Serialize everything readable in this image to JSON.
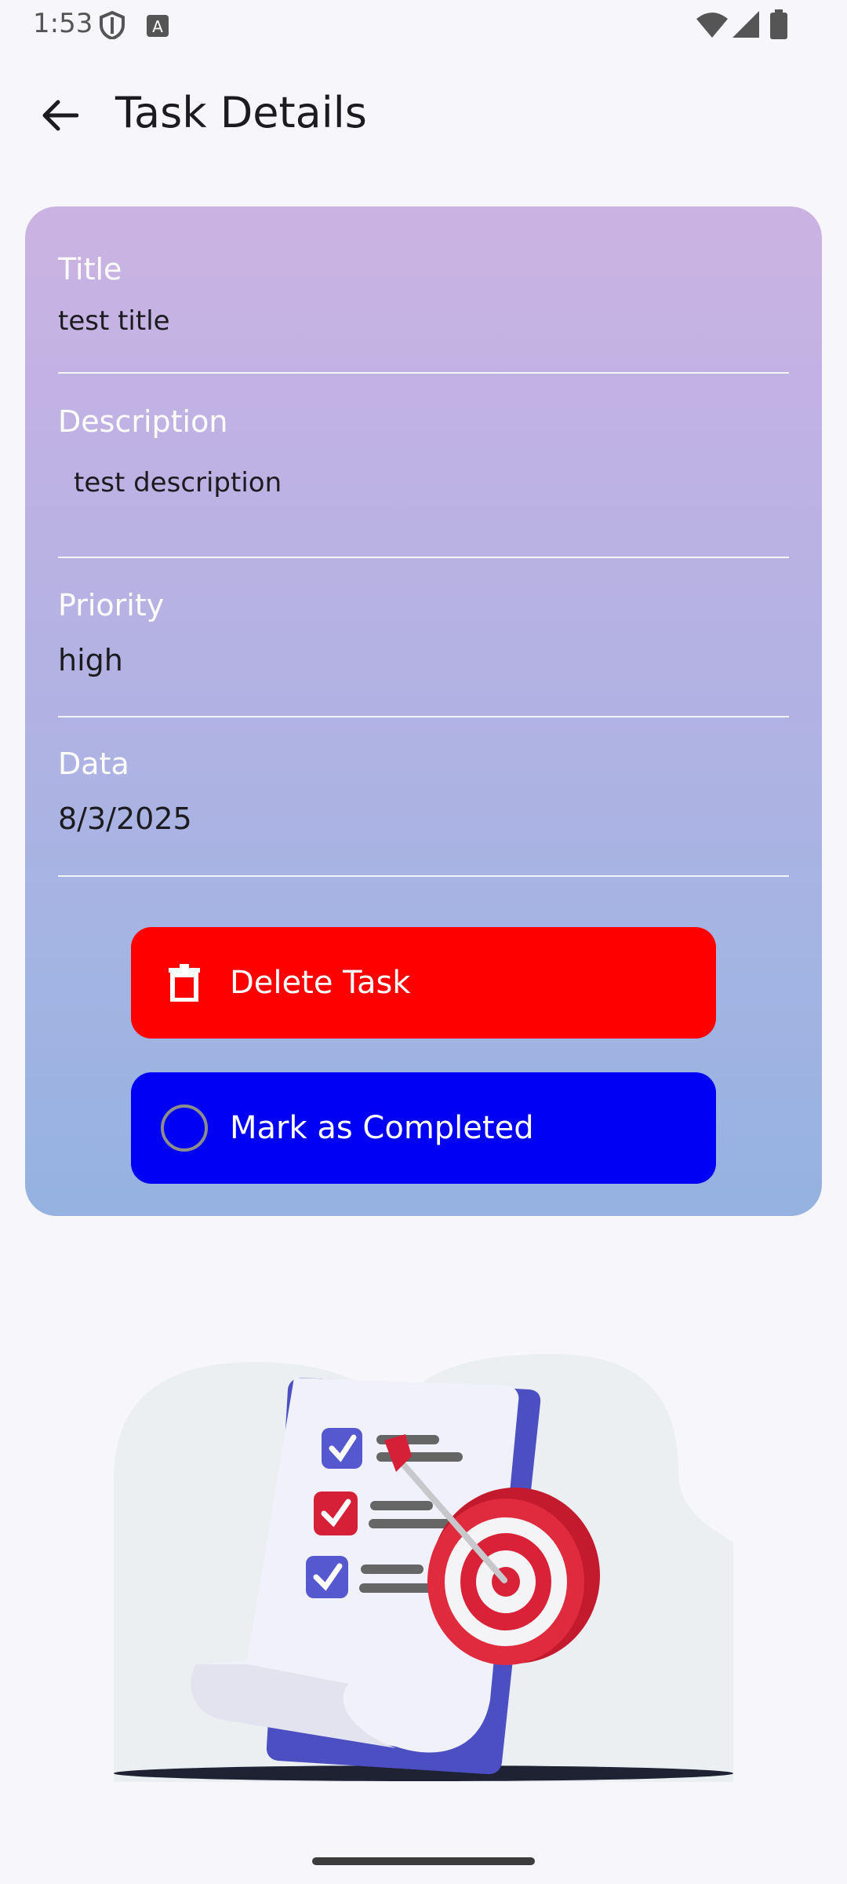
{
  "status_bar": {
    "time": "1:53",
    "icons": [
      "shield-icon",
      "keyboard-a-icon",
      "wifi-icon",
      "signal-icon",
      "battery-icon"
    ]
  },
  "header": {
    "back_icon": "arrow-back-icon",
    "title": "Task Details"
  },
  "task": {
    "title_label": "Title",
    "title_value": "test title",
    "description_label": "Description",
    "description_value": "test description",
    "priority_label": "Priority",
    "priority_value": "high",
    "date_label": "Data",
    "date_value": "8/3/2025"
  },
  "actions": {
    "delete_label": "Delete Task",
    "delete_icon": "trash-icon",
    "complete_label": "Mark as Completed",
    "complete_icon": "circle-outline-icon"
  },
  "colors": {
    "delete": "#ff0000",
    "complete": "#0000f5",
    "card_gradient_top": "#cbb3e3",
    "card_gradient_bottom": "#95b2e1"
  },
  "illustration": {
    "icon": "checklist-target-illustration"
  }
}
